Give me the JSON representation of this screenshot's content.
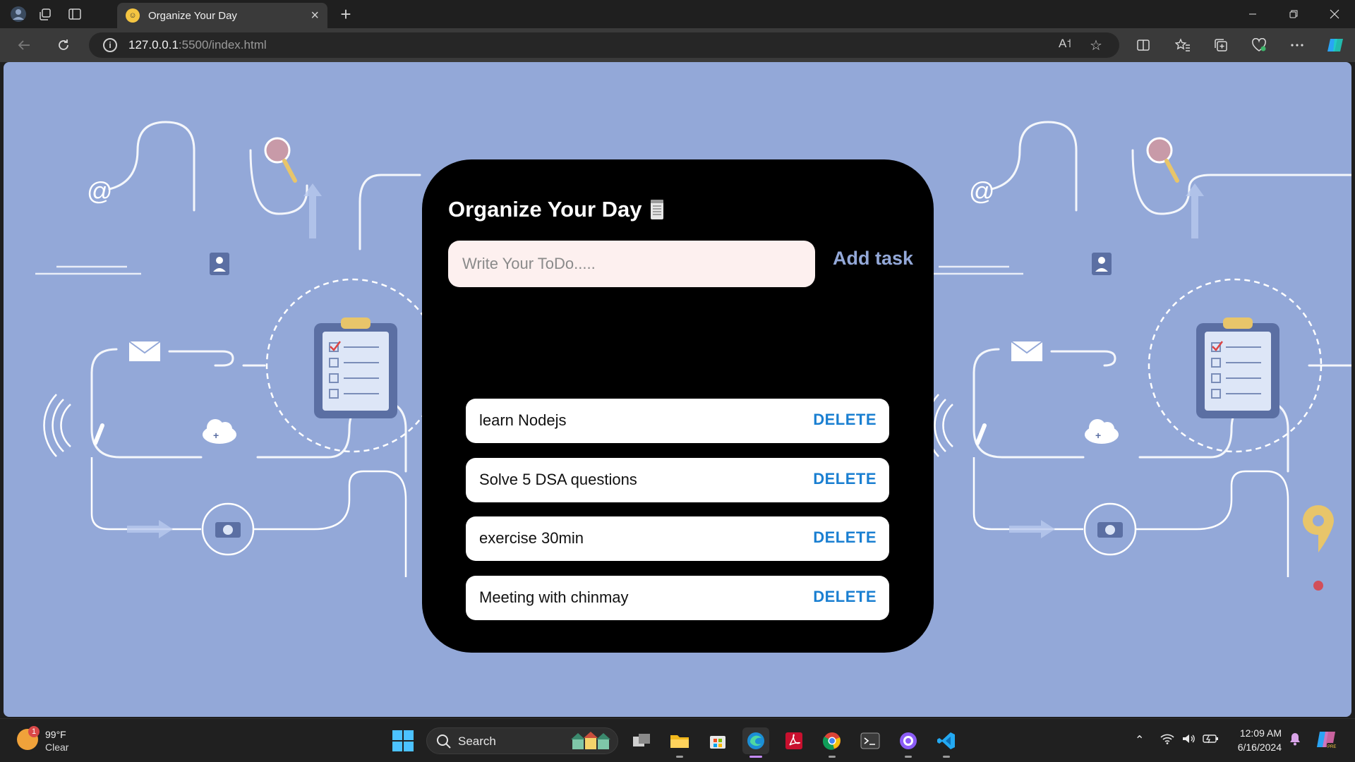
{
  "browser": {
    "tab_title": "Organize Your Day",
    "tab_close": "×",
    "new_tab": "+",
    "url_host": "127.0.0.1",
    "url_path": ":5500/index.html",
    "info_icon": "i",
    "read_aloud": "A˦"
  },
  "app": {
    "title": "Organize Your Day",
    "input_placeholder": "Write Your ToDo.....",
    "input_value": "",
    "add_label": "Add task",
    "tasks": [
      {
        "text": "learn Nodejs",
        "delete_label": "DELETE"
      },
      {
        "text": "Solve 5 DSA questions",
        "delete_label": "DELETE"
      },
      {
        "text": "exercise 30min",
        "delete_label": "DELETE"
      },
      {
        "text": "Meeting with chinmay",
        "delete_label": "DELETE"
      }
    ]
  },
  "taskbar": {
    "weather_temp": "99°F",
    "weather_condition": "Clear",
    "weather_badge": "1",
    "search_label": "Search",
    "clock_time": "12:09 AM",
    "clock_date": "6/16/2024"
  },
  "colors": {
    "page_background": "#93a8d8",
    "card": "#000000",
    "accent_button": "#93a8d8",
    "delete_text": "#1a7fd1",
    "input_background": "#fdf0ef"
  },
  "icons": [
    "profile-icon",
    "tab-actions-icon",
    "vertical-tabs-icon",
    "back-icon",
    "refresh-icon",
    "info-icon",
    "read-aloud-icon",
    "favorite-star-icon",
    "split-screen-icon",
    "favorites-icon",
    "collections-icon",
    "browser-essentials-icon",
    "more-icon",
    "copilot-icon",
    "minimize-icon",
    "restore-icon",
    "close-icon",
    "notepad-icon"
  ]
}
